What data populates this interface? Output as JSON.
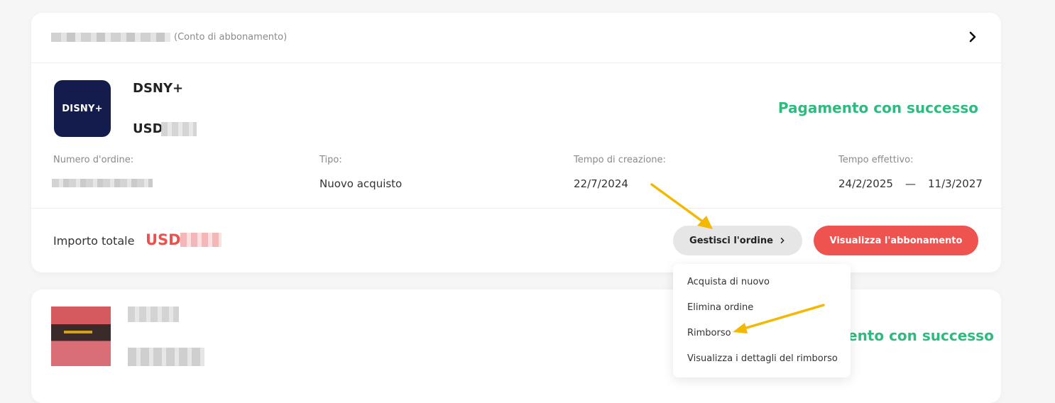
{
  "colors": {
    "success": "#2dbb7f",
    "primary_red": "#ef5350",
    "price_red": "#e8524f",
    "logo_bg": "#141b4d",
    "arrow_annotation": "#f5b800"
  },
  "order_card": {
    "account_suffix": "(Conto di abbonamento)",
    "header_icon": "chevron-right-icon",
    "product": {
      "logo_text": "DISNY+",
      "name": "DSNY+",
      "price_currency": "USD"
    },
    "status": "Pagamento con successo",
    "details": {
      "order_number_label": "Numero d'ordine:",
      "type_label": "Tipo:",
      "type_value": "Nuovo acquisto",
      "created_label": "Tempo di creazione:",
      "created_value": "22/7/2024",
      "effective_label": "Tempo effettivo:",
      "effective_start": "24/2/2025",
      "effective_separator": "—",
      "effective_end": "11/3/2027"
    },
    "footer": {
      "total_label": "Importo totale",
      "total_currency": "USD",
      "manage_button": "Gestisci l'ordine",
      "view_subscription_button": "Visualizza l'abbonamento"
    }
  },
  "manage_menu": {
    "items": [
      "Acquista di nuovo",
      "Elimina ordine",
      "Rimborso",
      "Visualizza i dettagli del rimborso"
    ]
  },
  "second_card": {
    "status_partial": "ento con successo"
  }
}
